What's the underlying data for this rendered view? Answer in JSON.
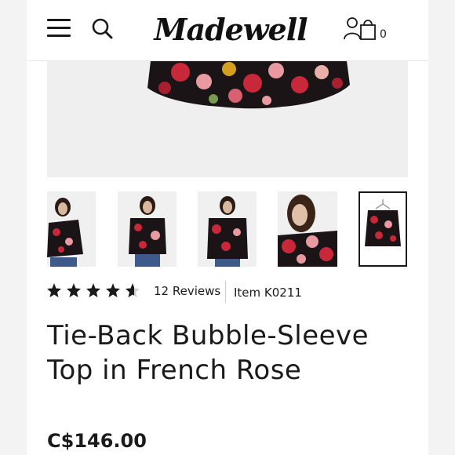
{
  "header": {
    "menu_icon": "menu-icon",
    "search_icon": "search-icon",
    "logo_text": "Madewell",
    "account_icon": "account-icon",
    "cart_icon": "shopping-bag-icon",
    "cart_count": "0"
  },
  "gallery": {
    "main_image": "floral-top-product-image",
    "thumbnails": [
      {
        "label": "model-front-view"
      },
      {
        "label": "model-arms-crossed-view"
      },
      {
        "label": "model-smiling-view"
      },
      {
        "label": "model-closeup-view"
      },
      {
        "label": "top-on-hanger-view"
      }
    ],
    "selected_index": 4
  },
  "rating": {
    "stars": 4.5,
    "reviews_text": "12 Reviews",
    "item_text": "Item K0211"
  },
  "product": {
    "title_line1": "Tie-Back Bubble-Sleeve",
    "title_line2": "Top in French Rose",
    "price": "C$146.00"
  },
  "colors": {
    "text": "#1a1a1a",
    "border": "#e6e6e6",
    "rose_red": "#c8283a",
    "rose_pink": "#e89aa0",
    "print_black": "#1b1416"
  }
}
